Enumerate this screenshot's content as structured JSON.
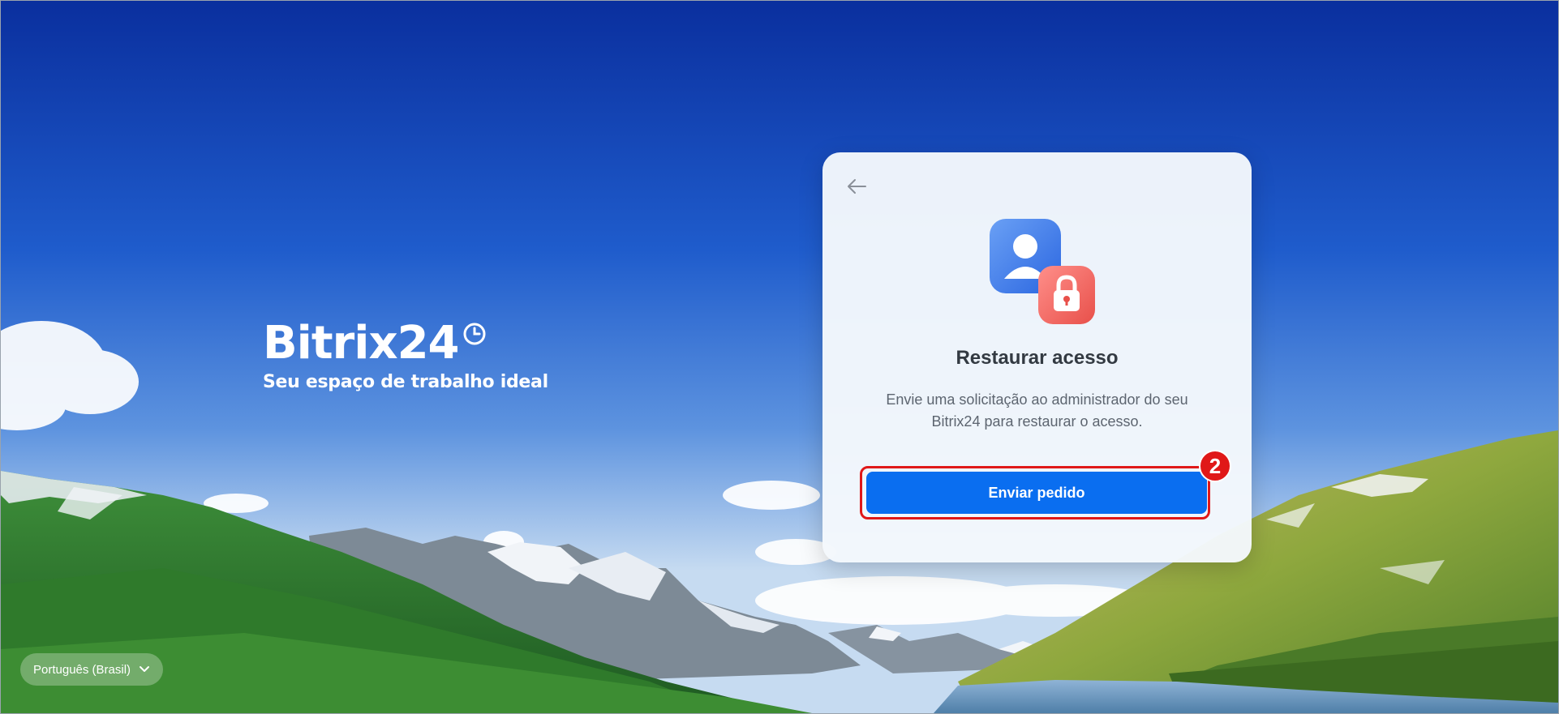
{
  "brand": {
    "logo_text": "Bitrix24",
    "tagline": "Seu espaço de trabalho ideal"
  },
  "card": {
    "back_icon": "arrow-left-icon",
    "illustration_icons": [
      "user-avatar-icon",
      "lock-icon"
    ],
    "title": "Restaurar acesso",
    "description": "Envie uma solicitação ao administrador do seu Bitrix24 para restaurar o acesso.",
    "button_label": "Enviar pedido",
    "step_number": "2"
  },
  "language": {
    "selected": "Português (Brasil)",
    "chevron_icon": "chevron-down-icon"
  },
  "colors": {
    "button": "#0a6ef0",
    "highlight": "#e01818",
    "title": "#333a42"
  }
}
